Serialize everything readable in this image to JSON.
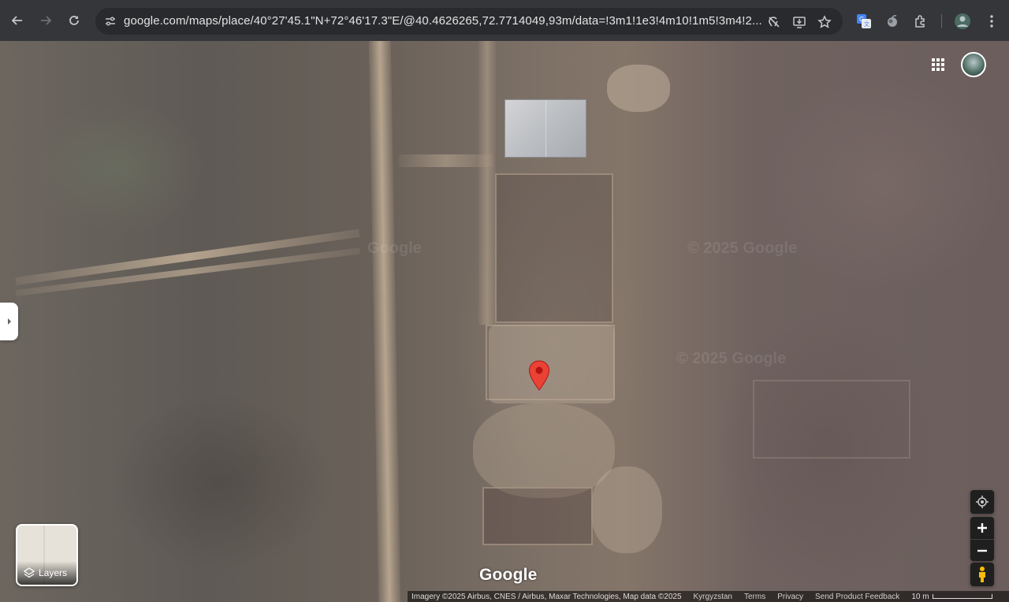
{
  "browser": {
    "url": "google.com/maps/place/40°27'45.1\"N+72°46'17.3\"E/@40.4626265,72.7714049,93m/data=!3m1!1e3!4m10!1m5!3m4!2..."
  },
  "map": {
    "type": "satellite",
    "watermarks": [
      "Google",
      "© 2025 Google",
      "© 2025 Google"
    ],
    "logo": "Google",
    "layers_label": "Layers",
    "attribution": "Imagery ©2025 Airbus, CNES / Airbus, Maxar Technologies, Map data ©2025",
    "region": "Kyrgyzstan",
    "terms": "Terms",
    "privacy": "Privacy",
    "feedback": "Send Product Feedback",
    "scale": "10 m"
  },
  "colors": {
    "pin": "#ea4335",
    "toolbar_bg": "#35363a",
    "omnibox_bg": "#282a2d",
    "controls_bg": "#1f1f1f"
  },
  "icons": {
    "toolbar": [
      "back-icon",
      "forward-icon",
      "reload-icon",
      "site-info-icon",
      "tracking-off-icon",
      "install-app-icon",
      "bookmark-star-icon",
      "translate-icon",
      "extension-icon",
      "puzzle-icon",
      "profile-icon",
      "menu-icon"
    ],
    "map": [
      "chevron-right-icon",
      "apps-grid-icon",
      "layers-icon",
      "locate-icon",
      "plus-icon",
      "minus-icon",
      "pegman-icon",
      "map-pin-icon"
    ]
  }
}
